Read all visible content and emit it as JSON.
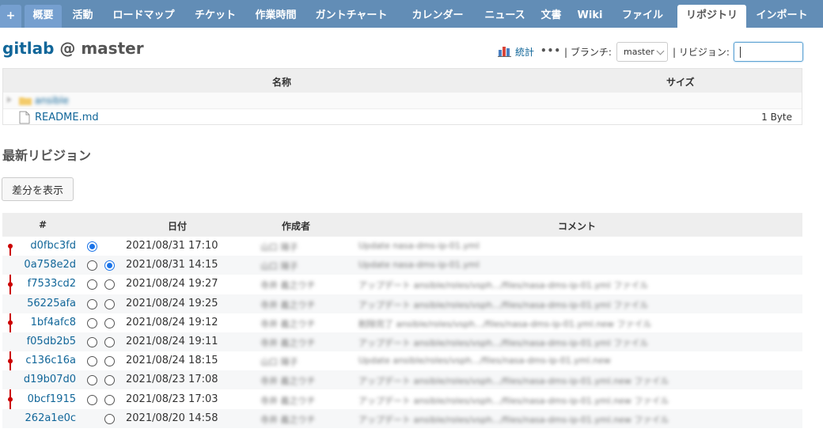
{
  "tabs": [
    {
      "label": "+",
      "name": "tab-new",
      "left": 0
    },
    {
      "label": "概要",
      "name": "tab-overview"
    },
    {
      "label": "活動",
      "name": "tab-activity"
    },
    {
      "label": "ロードマップ",
      "name": "tab-roadmap"
    },
    {
      "label": "チケット",
      "name": "tab-issues"
    },
    {
      "label": "作業時間",
      "name": "tab-time-entries"
    },
    {
      "label": "ガントチャート",
      "name": "tab-gantt"
    },
    {
      "label": "カレンダー",
      "name": "tab-calendar"
    },
    {
      "label": "ニュース",
      "name": "tab-news"
    },
    {
      "label": "文書",
      "name": "tab-documents"
    },
    {
      "label": "Wiki",
      "name": "tab-wiki"
    },
    {
      "label": "ファイル",
      "name": "tab-files"
    },
    {
      "label": "リポジトリ",
      "name": "tab-repository",
      "selected": true
    },
    {
      "label": "インポート",
      "name": "tab-import"
    }
  ],
  "title": {
    "repo": "gitlab",
    "separator": " @ ",
    "branch": "master"
  },
  "toolbar": {
    "stats_label": "統計",
    "more_label": "•••",
    "branch_label": "| ブランチ:",
    "branch_value": "master",
    "revision_label": "| リビジョン:",
    "revision_value": ""
  },
  "files": {
    "columns": [
      "名称",
      "サイズ"
    ],
    "rows": [
      {
        "type": "folder",
        "name": "ansible",
        "size": ""
      },
      {
        "type": "file",
        "name": "README.md",
        "size": "1 Byte"
      }
    ]
  },
  "revisions": {
    "heading": "最新リビジョン",
    "diff_button": "差分を表示",
    "columns": [
      "#",
      "日付",
      "作成者",
      "コメント"
    ],
    "rows": [
      {
        "id": "d0fbc3fd",
        "r1": "checked",
        "r2": "none",
        "date": "2021/08/31 17:10",
        "author": "山口 陽子",
        "comment": "Update nasa-dms-ip-01.yml"
      },
      {
        "id": "0a758e2d",
        "r1": "empty",
        "r2": "checked",
        "date": "2021/08/31 14:15",
        "author": "山口 陽子",
        "comment": "Update nasa-dms-ip-01.yml"
      },
      {
        "id": "f7533cd2",
        "r1": "empty",
        "r2": "empty",
        "date": "2021/08/24 19:27",
        "author": "寺井 義之ウチ",
        "comment": "アップデート ansible/roles/vsph.../files/nasa-dms-ip-01.yml ファイル"
      },
      {
        "id": "56225afa",
        "r1": "empty",
        "r2": "empty",
        "date": "2021/08/24 19:25",
        "author": "寺井 義之ウチ",
        "comment": "アップデート ansible/roles/vsph.../files/nasa-dms-ip-01.yml ファイル"
      },
      {
        "id": "1bf4afc8",
        "r1": "empty",
        "r2": "empty",
        "date": "2021/08/24 19:12",
        "author": "寺井 義之ウチ",
        "comment": "削除完了 ansible/roles/vsph.../files/nasa-dms-ip-01.yml.new ファイル"
      },
      {
        "id": "f05db2b5",
        "r1": "empty",
        "r2": "empty",
        "date": "2021/08/24 19:11",
        "author": "寺井 義之ウチ",
        "comment": "アップデート ansible/roles/vsph.../files/nasa-dms-ip-01.yml ファイル"
      },
      {
        "id": "c136c16a",
        "r1": "empty",
        "r2": "empty",
        "date": "2021/08/24 18:15",
        "author": "山口 陽子",
        "comment": "Update ansible/roles/vsph.../files/nasa-dms-ip-01.yml.new"
      },
      {
        "id": "d19b07d0",
        "r1": "empty",
        "r2": "empty",
        "date": "2021/08/23 17:08",
        "author": "寺井 義之ウチ",
        "comment": "アップデート ansible/roles/vsph.../files/nasa-dms-ip-01.yml.new ファイル"
      },
      {
        "id": "0bcf1915",
        "r1": "empty",
        "r2": "empty",
        "date": "2021/08/23 17:03",
        "author": "寺井 義之ウチ",
        "comment": "アップデート ansible/roles/vsph.../files/nasa-dms-ip-01.yml.new ファイル"
      },
      {
        "id": "262a1e0c",
        "r1": "none",
        "r2": "empty",
        "date": "2021/08/20 14:58",
        "author": "寺井 義之ウチ",
        "comment": "アップデート ansible/roles/vsph.../files/nasa-dms-ip-01.yml.new ファイル"
      }
    ]
  },
  "colors": {
    "header": "#628db6",
    "link": "#116699",
    "graph": "#cc0000"
  }
}
